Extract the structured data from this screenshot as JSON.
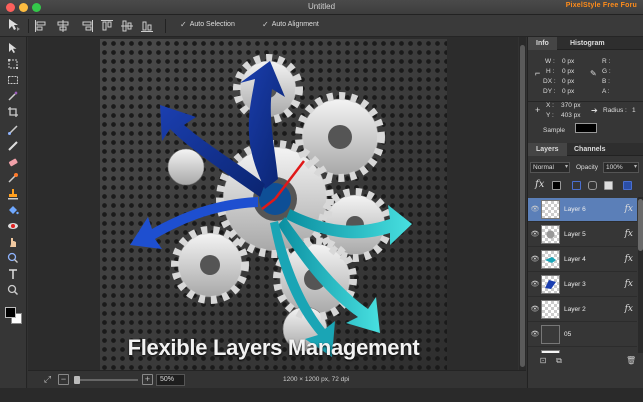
{
  "window": {
    "title": "Untitled",
    "brand": "PixelStyle Free Foru"
  },
  "toolbar": {
    "auto_selection_label": "Auto Selection",
    "auto_alignment_label": "Auto Alignment"
  },
  "canvas": {
    "banner_text": "Flexible Layers Management"
  },
  "statusbar": {
    "zoom": "50%",
    "doc_info": "1200 × 1200 px, 72 dpi"
  },
  "info_panel": {
    "tab_info": "Info",
    "tab_histogram": "Histogram",
    "w_label": "W :",
    "w_value": "0 px",
    "h_label": "H :",
    "h_value": "0 px",
    "dx_label": "DX :",
    "dx_value": "0 px",
    "dy_label": "DY :",
    "dy_value": "0 px",
    "r_label": "R :",
    "g_label": "G :",
    "b_label": "B :",
    "a_label": "A :",
    "x_label": "X :",
    "x_value": "370 px",
    "y_label": "Y :",
    "y_value": "403 px",
    "radius_label": "Radius :",
    "radius_value": "1",
    "sample_label": "Sample"
  },
  "layers_panel": {
    "tab_layers": "Layers",
    "tab_channels": "Channels",
    "blend_mode": "Normal",
    "opacity_label": "Opacity",
    "opacity_value": "100%",
    "fx_label": "fx",
    "layers": [
      {
        "name": "Layer 6",
        "selected": true
      },
      {
        "name": "Layer 5",
        "selected": false
      },
      {
        "name": "Layer 4",
        "selected": false
      },
      {
        "name": "Layer 3",
        "selected": false
      },
      {
        "name": "Layer 2",
        "selected": false
      },
      {
        "name": "05",
        "selected": false
      }
    ]
  },
  "colors": {
    "accent_selection": "#5b7fb8",
    "brand_orange": "#ff8c1a",
    "foreground": "#000000",
    "background": "#ffffff"
  }
}
